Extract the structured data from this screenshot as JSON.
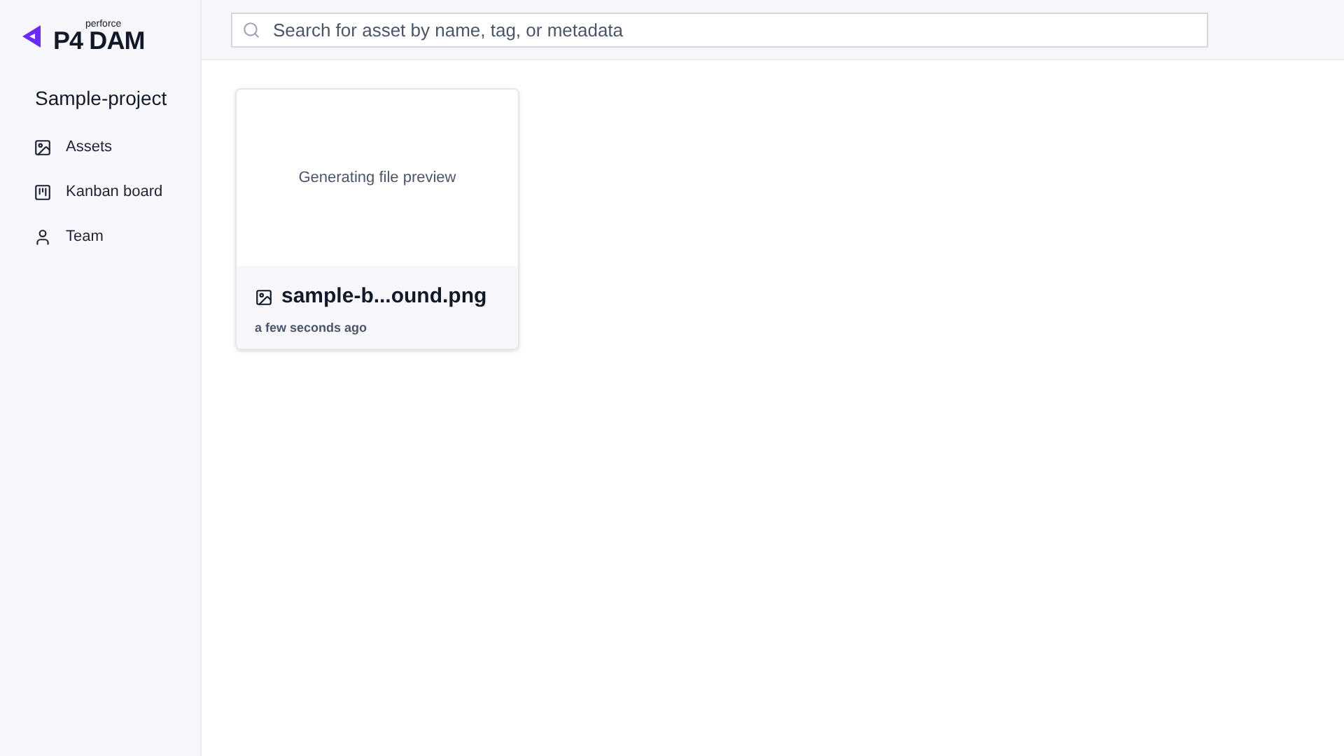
{
  "logo": {
    "brand": "perforce",
    "product": "P4 DAM"
  },
  "project": {
    "title": "Sample-project"
  },
  "sidebar": {
    "items": [
      {
        "label": "Assets",
        "kind": "image"
      },
      {
        "label": "Kanban board",
        "kind": "kanban"
      },
      {
        "label": "Team",
        "kind": "user"
      }
    ]
  },
  "search": {
    "placeholder": "Search for asset by name, tag, or metadata"
  },
  "assets": [
    {
      "preview": "Generating file preview",
      "name": "sample-b...ound.png",
      "time": "a few seconds ago"
    }
  ]
}
